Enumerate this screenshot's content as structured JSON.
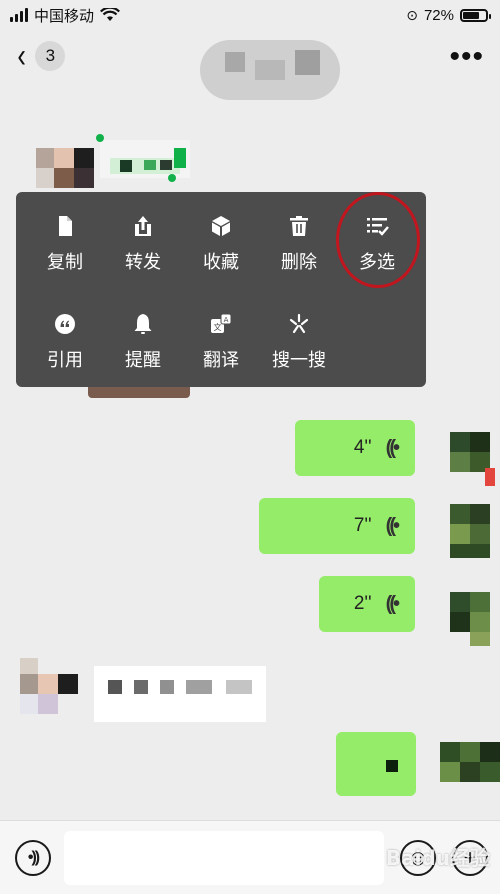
{
  "status_bar": {
    "carrier": "中国移动",
    "battery_percent_label": "72%",
    "battery_level": 0.72
  },
  "nav": {
    "unread_count": "3",
    "more_label": "•••"
  },
  "context_menu": {
    "items": [
      {
        "label": "复制",
        "icon": "document-icon"
      },
      {
        "label": "转发",
        "icon": "share-icon"
      },
      {
        "label": "收藏",
        "icon": "cube-icon"
      },
      {
        "label": "删除",
        "icon": "trash-icon"
      },
      {
        "label": "多选",
        "icon": "multi-select-icon"
      },
      {
        "label": "引用",
        "icon": "quote-icon"
      },
      {
        "label": "提醒",
        "icon": "bell-icon"
      },
      {
        "label": "翻译",
        "icon": "translate-icon"
      },
      {
        "label": "搜一搜",
        "icon": "search-spark-icon"
      }
    ]
  },
  "messages": {
    "voice": [
      {
        "duration": "4''"
      },
      {
        "duration": "7''"
      },
      {
        "duration": "2''"
      }
    ]
  },
  "colors": {
    "bubble_green": "#95ec69",
    "menu_bg": "#4c4c4c",
    "highlight_red": "#c1161e",
    "chat_bg": "#ededed"
  },
  "watermark": "Baidu经验"
}
